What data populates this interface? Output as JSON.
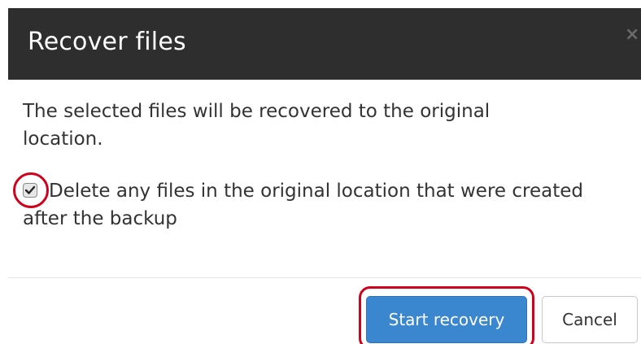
{
  "dialog": {
    "title": "Recover files",
    "close_glyph": "×",
    "message": "The selected files will be recovered to the original location.",
    "option": {
      "checked": true,
      "label": "Delete any files in the original location that were created after the backup"
    },
    "buttons": {
      "primary_label": "Start recovery",
      "cancel_label": "Cancel"
    }
  },
  "colors": {
    "header_bg": "#2e2e2e",
    "primary": "#3a87cf",
    "highlight": "#d0011b"
  }
}
